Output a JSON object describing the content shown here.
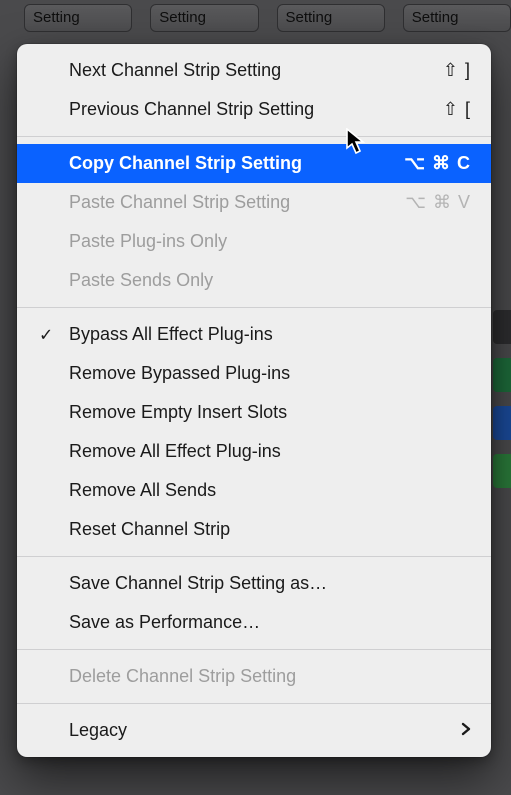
{
  "bg": {
    "button_label": "Setting",
    "slot_colors": [
      "#2d2d2f",
      "#1d6a3a",
      "#1a4a9a",
      "#2a7a3a"
    ]
  },
  "menu": {
    "items": [
      {
        "label": "Next Channel Strip Setting",
        "shortcut": "⇧ ]",
        "type": "item"
      },
      {
        "label": "Previous Channel Strip Setting",
        "shortcut": "⇧ [",
        "type": "item"
      },
      {
        "type": "separator"
      },
      {
        "label": "Copy Channel Strip Setting",
        "shortcut": "⌥ ⌘ C",
        "type": "item",
        "selected": true
      },
      {
        "label": "Paste Channel Strip Setting",
        "shortcut": "⌥ ⌘ V",
        "type": "item",
        "disabled": true
      },
      {
        "label": "Paste Plug-ins Only",
        "type": "item",
        "disabled": true
      },
      {
        "label": "Paste Sends Only",
        "type": "item",
        "disabled": true
      },
      {
        "type": "separator"
      },
      {
        "label": "Bypass All Effect Plug-ins",
        "type": "item",
        "checked": true
      },
      {
        "label": "Remove Bypassed Plug-ins",
        "type": "item"
      },
      {
        "label": "Remove Empty Insert Slots",
        "type": "item"
      },
      {
        "label": "Remove All Effect Plug-ins",
        "type": "item"
      },
      {
        "label": "Remove All Sends",
        "type": "item"
      },
      {
        "label": "Reset Channel Strip",
        "type": "item"
      },
      {
        "type": "separator"
      },
      {
        "label": "Save Channel Strip Setting as…",
        "type": "item"
      },
      {
        "label": "Save as Performance…",
        "type": "item"
      },
      {
        "type": "separator"
      },
      {
        "label": "Delete Channel Strip Setting",
        "type": "item",
        "disabled": true
      },
      {
        "type": "separator"
      },
      {
        "label": "Legacy",
        "type": "submenu"
      }
    ]
  },
  "glyphs": {
    "check": "✓"
  }
}
